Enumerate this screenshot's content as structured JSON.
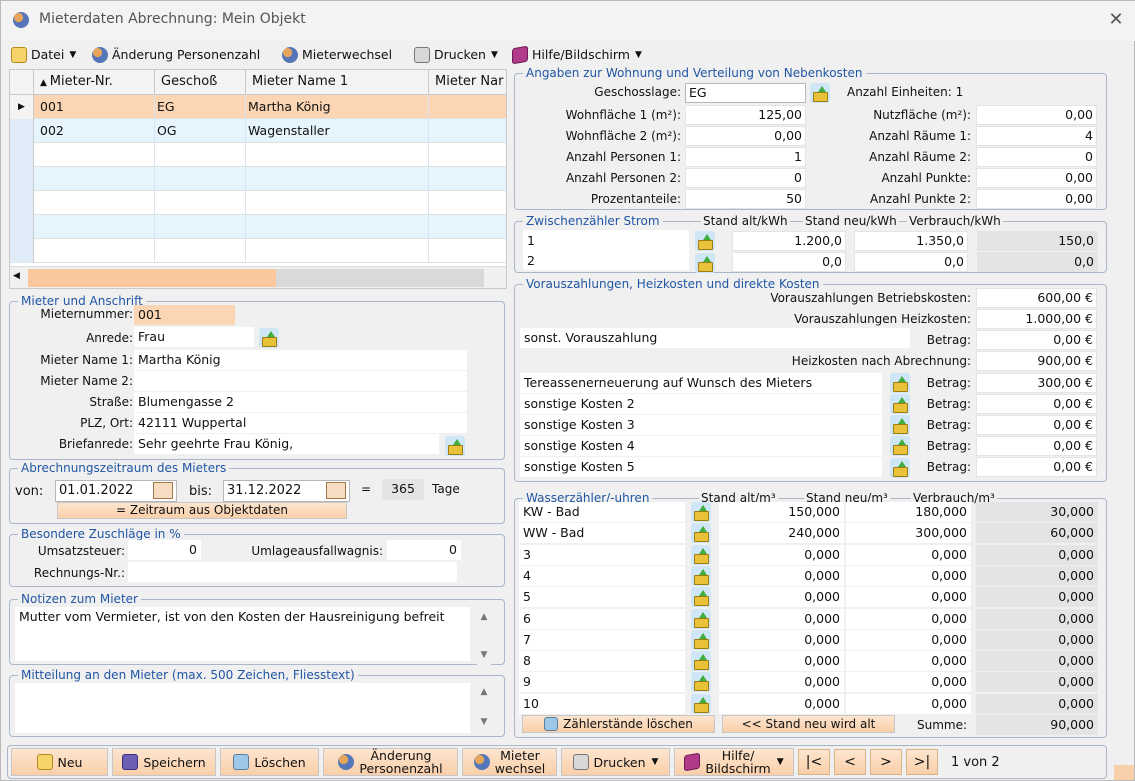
{
  "window": {
    "title": "Mieterdaten  Abrechnung: Mein Objekt",
    "close": "✕"
  },
  "menu": {
    "datei": "Datei",
    "aenderung": "Änderung Personenzahl",
    "mieterwechsel": "Mieterwechsel",
    "drucken": "Drucken",
    "hilfe": "Hilfe/Bildschirm"
  },
  "grid": {
    "columns": [
      "Mieter-Nr.",
      "Geschoß",
      "Mieter Name 1",
      "Mieter Nar"
    ],
    "rows": [
      {
        "nr": "001",
        "geschoss": "EG",
        "name": "Martha König"
      },
      {
        "nr": "002",
        "geschoss": "OG",
        "name": "Wagenstaller"
      }
    ]
  },
  "mieter": {
    "legend": "Mieter und Anschrift",
    "labels": {
      "nummer": "Mieternummer:",
      "anrede": "Anrede:",
      "name1": "Mieter Name 1:",
      "name2": "Mieter Name 2:",
      "strasse": "Straße:",
      "plz": "PLZ, Ort:",
      "brief": "Briefanrede:"
    },
    "values": {
      "nummer": "001",
      "anrede": "Frau",
      "name1": "Martha König",
      "name2": "",
      "strasse": "Blumengasse 2",
      "plz": "42111 Wuppertal",
      "brief": "Sehr geehrte Frau König,"
    }
  },
  "zeitraum": {
    "legend": "Abrechnungszeitraum des Mieters",
    "von_label": "von:",
    "von": "01.01.2022",
    "bis_label": "bis:",
    "bis": "31.12.2022",
    "eq": "=",
    "tage": "365",
    "tage_label": "Tage",
    "button": "= Zeitraum aus Objektdaten"
  },
  "zuschlaege": {
    "legend": "Besondere Zuschläge in %",
    "ust_label": "Umsatzsteuer:",
    "ust": "0",
    "umlage_label": "Umlageausfallwagnis:",
    "umlage": "0",
    "rechnung_label": "Rechnungs-Nr.:",
    "rechnung": ""
  },
  "notizen": {
    "legend": "Notizen zum Mieter",
    "text": "Mutter vom Vermieter, ist von den Kosten der Hausreinigung befreit"
  },
  "mitteilung": {
    "legend": "Mitteilung an den Mieter (max. 500 Zeichen, Fliesstext)",
    "text": ""
  },
  "wohnung": {
    "legend": "Angaben zur Wohnung und Verteilung von Nebenkosten",
    "geschoss_label": "Geschosslage:",
    "geschoss": "EG",
    "einheiten": "Anzahl Einheiten: 1",
    "left": [
      {
        "label": "Wohnfläche 1 (m²):",
        "value": "125,00"
      },
      {
        "label": "Wohnfläche 2 (m²):",
        "value": "0,00"
      },
      {
        "label": "Anzahl Personen 1:",
        "value": "1"
      },
      {
        "label": "Anzahl Personen 2:",
        "value": "0"
      },
      {
        "label": "Prozentanteile:",
        "value": "50"
      }
    ],
    "right": [
      {
        "label": "Nutzfläche (m²):",
        "value": "0,00"
      },
      {
        "label": "Anzahl Räume 1:",
        "value": "4"
      },
      {
        "label": "Anzahl Räume 2:",
        "value": "0"
      },
      {
        "label": "Anzahl Punkte:",
        "value": "0,00"
      },
      {
        "label": "Anzahl Punkte 2:",
        "value": "0,00"
      }
    ]
  },
  "strom": {
    "legend": "Zwischenzähler Strom",
    "h_alt": "Stand alt/kWh",
    "h_neu": "Stand neu/kWh",
    "h_verb": "Verbrauch/kWh",
    "rows": [
      {
        "name": "1",
        "alt": "1.200,0",
        "neu": "1.350,0",
        "verb": "150,0"
      },
      {
        "name": "2",
        "alt": "0,0",
        "neu": "0,0",
        "verb": "0,0"
      }
    ]
  },
  "voraus": {
    "legend": "Vorauszahlungen, Heizkosten und direkte Kosten",
    "betrieb_label": "Vorauszahlungen Betriebskosten:",
    "betrieb": "600,00 €",
    "heiz_label": "Vorauszahlungen Heizkosten:",
    "heiz": "1.000,00 €",
    "sonst_text": "sonst. Vorauszahlung",
    "betrag_label": "Betrag:",
    "sonst": "0,00 €",
    "heizabr_label": "Heizkosten nach Abrechnung:",
    "heizabr": "900,00 €",
    "kosten": [
      {
        "text": "Tereassenerneuerung auf Wunsch des Mieters",
        "betrag": "300,00 €"
      },
      {
        "text": "sonstige Kosten 2",
        "betrag": "0,00 €"
      },
      {
        "text": "sonstige Kosten 3",
        "betrag": "0,00 €"
      },
      {
        "text": "sonstige Kosten 4",
        "betrag": "0,00 €"
      },
      {
        "text": "sonstige Kosten 5",
        "betrag": "0,00 €"
      }
    ]
  },
  "wasser": {
    "legend": "Wasserzähler/-uhren",
    "h_alt": "Stand alt/m³",
    "h_neu": "Stand neu/m³",
    "h_verb": "Verbrauch/m³",
    "rows": [
      {
        "name": "KW - Bad",
        "alt": "150,000",
        "neu": "180,000",
        "verb": "30,000"
      },
      {
        "name": "WW - Bad",
        "alt": "240,000",
        "neu": "300,000",
        "verb": "60,000"
      },
      {
        "name": "3",
        "alt": "0,000",
        "neu": "0,000",
        "verb": "0,000"
      },
      {
        "name": "4",
        "alt": "0,000",
        "neu": "0,000",
        "verb": "0,000"
      },
      {
        "name": "5",
        "alt": "0,000",
        "neu": "0,000",
        "verb": "0,000"
      },
      {
        "name": "6",
        "alt": "0,000",
        "neu": "0,000",
        "verb": "0,000"
      },
      {
        "name": "7",
        "alt": "0,000",
        "neu": "0,000",
        "verb": "0,000"
      },
      {
        "name": "8",
        "alt": "0,000",
        "neu": "0,000",
        "verb": "0,000"
      },
      {
        "name": "9",
        "alt": "0,000",
        "neu": "0,000",
        "verb": "0,000"
      },
      {
        "name": "10",
        "alt": "0,000",
        "neu": "0,000",
        "verb": "0,000"
      }
    ],
    "btn_loeschen": "Zählerstände löschen",
    "btn_alt": "<< Stand neu wird alt",
    "summe_label": "Summe:",
    "summe": "90,000"
  },
  "footer": {
    "neu": "Neu",
    "speichern": "Speichern",
    "loeschen": "Löschen",
    "aenderung1": "Änderung",
    "aenderung2": "Personenzahl",
    "mieter1": "Mieter",
    "mieter2": "wechsel",
    "drucken": "Drucken",
    "hilfe1": "Hilfe/",
    "hilfe2": "Bildschirm",
    "first": "|<",
    "prev": "<",
    "next": ">",
    "last": ">|",
    "position": "1 von 2"
  },
  "icons": [
    "people-icon",
    "close-icon",
    "file-icon",
    "print-icon",
    "book-icon",
    "picker-icon",
    "calendar-icon",
    "save-icon",
    "trash-icon"
  ]
}
